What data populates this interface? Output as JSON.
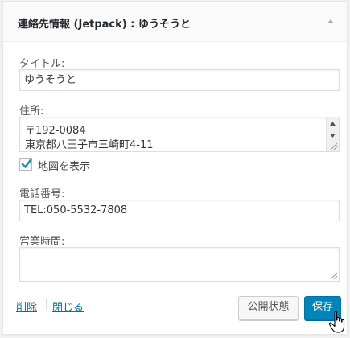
{
  "widget": {
    "title_prefix": "連絡先情報",
    "title_jetpack": "(Jetpack)",
    "title_suffix": ": ゆうそうと",
    "toggle_icon": "arrow-up-icon"
  },
  "fields": {
    "title_label": "タイトル:",
    "title_value": "ゆうそうと",
    "address_label": "住所:",
    "address_lines": [
      "〒192-0084",
      "東京都八王子市三崎町4-11"
    ],
    "map_label": "地図を表示",
    "map_checked": true,
    "phone_label": "電話番号:",
    "phone_value": "TEL:050-5532-7808",
    "hours_label": "営業時間:",
    "hours_value": ""
  },
  "actions": {
    "delete_label": "削除",
    "separator": "|",
    "close_label": "閉じる",
    "status_label": "公開状態",
    "save_label": "保存"
  },
  "colors": {
    "accent": "#0085ba",
    "link": "#0073aa"
  }
}
